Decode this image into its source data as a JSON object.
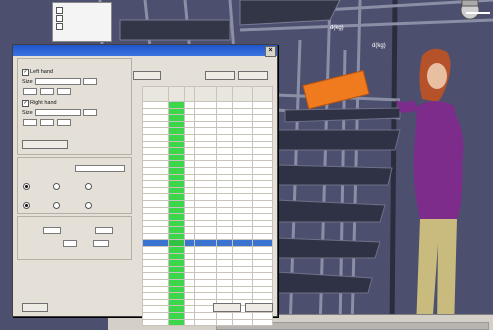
{
  "scene": {
    "labels": [
      "d(kg)",
      "d(kg)"
    ],
    "bottom_panel_title": ""
  },
  "tree": {
    "items": [
      "",
      "",
      ""
    ]
  },
  "dialog": {
    "title": "",
    "close_glyph": "×",
    "tasks_header": "",
    "left_hand_label": "Left hand",
    "right_hand_label": "Right hand",
    "size_label": "Size",
    "cancel_button": "",
    "apply_button": "",
    "close_button": "",
    "support_header": "",
    "stance_header": "",
    "stance_options": [
      "",
      "",
      ""
    ],
    "extra_support_header": "",
    "extra_support_options": [
      "",
      "",
      ""
    ],
    "time_header": "",
    "force_options": "",
    "select_button": "",
    "reset_table_button": "",
    "save_table_button": "",
    "table_header": "",
    "table_columns": [
      "",
      "",
      "",
      "",
      "",
      "",
      ""
    ],
    "table_rows": [
      [
        "",
        "",
        "",
        "",
        "",
        "",
        ""
      ],
      [
        "",
        "",
        "",
        "",
        "",
        "",
        ""
      ],
      [
        "",
        "",
        "",
        "",
        "",
        "",
        ""
      ],
      [
        "",
        "",
        "",
        "",
        "",
        "",
        ""
      ],
      [
        "",
        "",
        "",
        "",
        "",
        "",
        ""
      ],
      [
        "",
        "",
        "",
        "",
        "",
        "",
        ""
      ],
      [
        "",
        "",
        "",
        "",
        "",
        "",
        ""
      ],
      [
        "",
        "",
        "",
        "",
        "",
        "",
        ""
      ],
      [
        "",
        "",
        "",
        "",
        "",
        "",
        ""
      ],
      [
        "",
        "",
        "",
        "",
        "",
        "",
        ""
      ],
      [
        "",
        "",
        "",
        "",
        "",
        "",
        ""
      ],
      [
        "",
        "",
        "",
        "",
        "",
        "",
        ""
      ],
      [
        "",
        "",
        "",
        "",
        "",
        "",
        ""
      ],
      [
        "",
        "",
        "",
        "",
        "",
        "",
        ""
      ],
      [
        "",
        "",
        "",
        "",
        "",
        "",
        ""
      ],
      [
        "",
        "",
        "",
        "",
        "",
        "",
        ""
      ],
      [
        "",
        "",
        "",
        "",
        "",
        "",
        ""
      ],
      [
        "",
        "",
        "",
        "",
        "",
        "",
        ""
      ],
      [
        "",
        "",
        "",
        "",
        "",
        "",
        ""
      ],
      [
        "",
        "",
        "",
        "",
        "",
        "",
        ""
      ],
      [
        "",
        "",
        "",
        "",
        "",
        "",
        ""
      ],
      [
        "",
        "",
        "",
        "",
        "",
        "",
        ""
      ],
      [
        "",
        "",
        "",
        "",
        "",
        "",
        ""
      ],
      [
        "",
        "",
        "",
        "",
        "",
        "",
        ""
      ],
      [
        "",
        "",
        "",
        "",
        "",
        "",
        ""
      ],
      [
        "",
        "",
        "",
        "",
        "",
        "",
        ""
      ],
      [
        "",
        "",
        "",
        "",
        "",
        "",
        ""
      ],
      [
        "",
        "",
        "",
        "",
        "",
        "",
        ""
      ],
      [
        "",
        "",
        "",
        "",
        "",
        "",
        ""
      ],
      [
        "",
        "",
        "",
        "",
        "",
        "",
        ""
      ],
      [
        "",
        "",
        "",
        "",
        "",
        "",
        ""
      ],
      [
        "",
        "",
        "",
        "",
        "",
        "",
        ""
      ],
      [
        "",
        "",
        "",
        "",
        "",
        "",
        ""
      ],
      [
        "",
        "",
        "",
        "",
        "",
        "",
        ""
      ]
    ],
    "selected_row": 21,
    "footer_note": "",
    "left_hand_fields": [
      "",
      "",
      "",
      ""
    ],
    "right_hand_fields": [
      "",
      "",
      "",
      ""
    ],
    "size_value_left": "",
    "size_value_right": "",
    "stance_select": "",
    "time_fields": [
      "",
      ""
    ],
    "frequency_value": "",
    "duration_value": ""
  },
  "colors": {
    "selection": "#3b73d0",
    "ok_cell": "#3cd64a",
    "titlebar": "#1f55cc",
    "box": "#f07a1e"
  }
}
